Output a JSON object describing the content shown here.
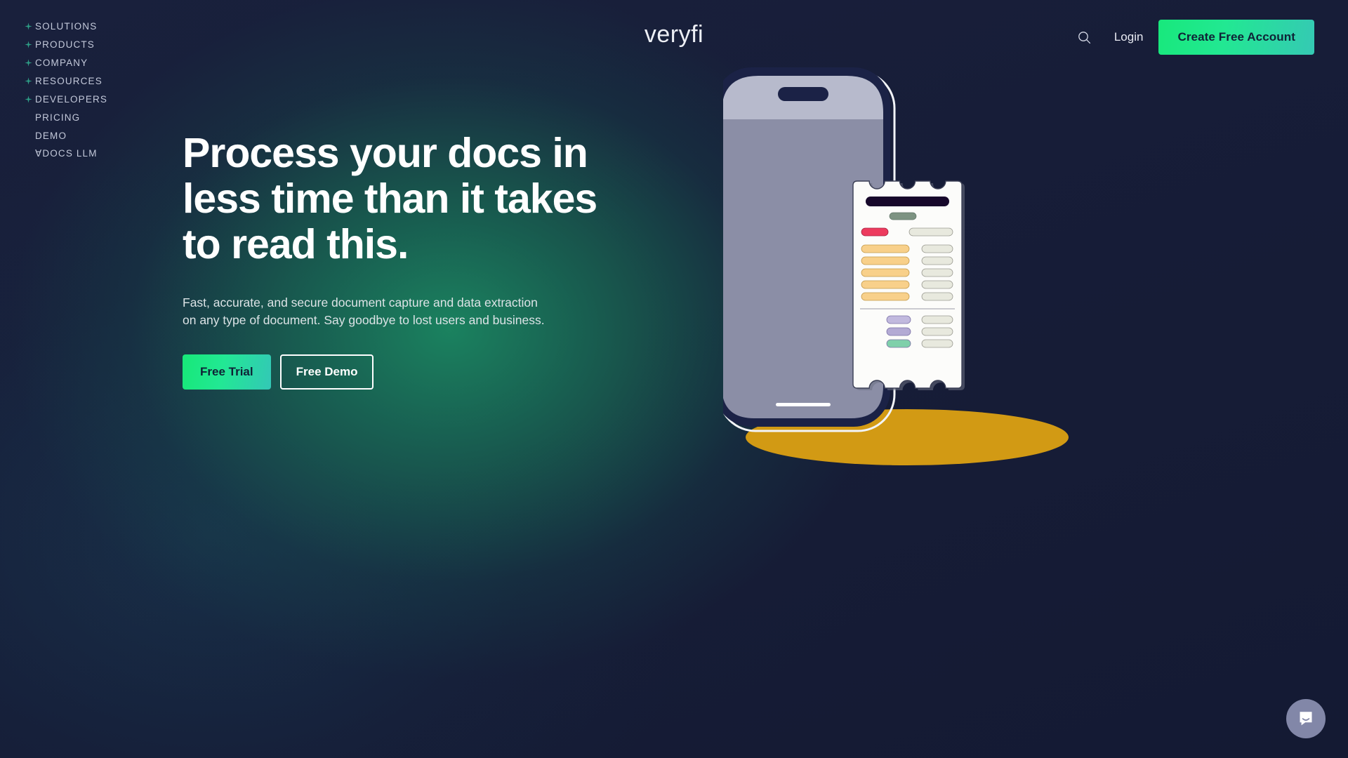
{
  "header": {
    "logo_text": "veryfi",
    "search_icon": "search-icon",
    "login_label": "Login",
    "cta_label": "Create Free Account",
    "cta_gradient_from": "#18E87C",
    "cta_gradient_to": "#35C9B4"
  },
  "nav": {
    "items": [
      {
        "label": "SOLUTIONS",
        "has_sparkle": true
      },
      {
        "label": "PRODUCTS",
        "has_sparkle": true
      },
      {
        "label": "COMPANY",
        "has_sparkle": true
      },
      {
        "label": "RESOURCES",
        "has_sparkle": true
      },
      {
        "label": "DEVELOPERS",
        "has_sparkle": true
      },
      {
        "label": "PRICING",
        "has_sparkle": false
      },
      {
        "label": "DEMO",
        "has_sparkle": false
      },
      {
        "label": "∀DOCS LLM",
        "has_sparkle": false
      }
    ],
    "sparkle_color": "#2E9E86"
  },
  "hero": {
    "headline": "Process your docs in\nless time than it takes\nto read this.",
    "subhead": "Fast, accurate, and secure document capture and data extraction\non any type of document. Say goodbye to lost users and business.",
    "primary_button": "Free Trial",
    "secondary_button": "Free Demo"
  },
  "illustration": {
    "name": "phone-with-receipt",
    "shadow_ellipse_color": "#D29A14",
    "phone_frame_color": "#1B2246",
    "phone_topbar_color": "#B7BACC",
    "phone_screen_color": "#8B8EA6",
    "receipt_color": "#FCFCFA",
    "receipt_rows": [
      {
        "kind": "header",
        "color": "#17082B",
        "width": 82
      },
      {
        "kind": "subtitle",
        "color": "#7D9382",
        "width": 38
      },
      {
        "kind": "pair",
        "color": "#ED3B5E",
        "amount_color": "#E8E9DE"
      },
      {
        "kind": "item",
        "color": "#F8D08A",
        "amount_color": "#E8E9DE"
      },
      {
        "kind": "item",
        "color": "#F8D08A",
        "amount_color": "#E8E9DE"
      },
      {
        "kind": "item",
        "color": "#F8D08A",
        "amount_color": "#E8E9DE"
      },
      {
        "kind": "item",
        "color": "#F8D08A",
        "amount_color": "#E8E9DE"
      },
      {
        "kind": "item",
        "color": "#F8D08A",
        "amount_color": "#E8E9DE"
      },
      {
        "kind": "total",
        "color": "#C1B9DE",
        "amount_color": "#E8E9DE"
      },
      {
        "kind": "total",
        "color": "#B3AAD4",
        "amount_color": "#E8E9DE"
      },
      {
        "kind": "total",
        "color": "#7FD0AA",
        "amount_color": "#E8E9DE"
      }
    ]
  },
  "chat": {
    "icon": "chat-bubble-icon",
    "bubble_color": "#8287A8"
  }
}
